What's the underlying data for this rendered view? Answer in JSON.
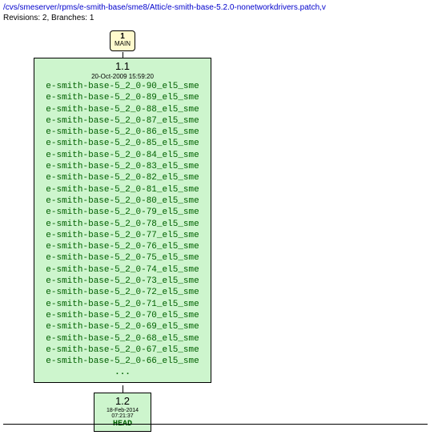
{
  "header": {
    "path": "/cvs/smeserver/rpms/e-smith-base/sme8/Attic/e-smith-base-5.2.0-nonetworkdrivers.patch,v",
    "info": "Revisions: 2, Branches: 1"
  },
  "branch": {
    "number": "1",
    "name": "MAIN"
  },
  "rev1": {
    "version": "1.1",
    "date": "20-Oct-2009 15:59:20",
    "tags": [
      "e-smith-base-5_2_0-90_el5_sme",
      "e-smith-base-5_2_0-89_el5_sme",
      "e-smith-base-5_2_0-88_el5_sme",
      "e-smith-base-5_2_0-87_el5_sme",
      "e-smith-base-5_2_0-86_el5_sme",
      "e-smith-base-5_2_0-85_el5_sme",
      "e-smith-base-5_2_0-84_el5_sme",
      "e-smith-base-5_2_0-83_el5_sme",
      "e-smith-base-5_2_0-82_el5_sme",
      "e-smith-base-5_2_0-81_el5_sme",
      "e-smith-base-5_2_0-80_el5_sme",
      "e-smith-base-5_2_0-79_el5_sme",
      "e-smith-base-5_2_0-78_el5_sme",
      "e-smith-base-5_2_0-77_el5_sme",
      "e-smith-base-5_2_0-76_el5_sme",
      "e-smith-base-5_2_0-75_el5_sme",
      "e-smith-base-5_2_0-74_el5_sme",
      "e-smith-base-5_2_0-73_el5_sme",
      "e-smith-base-5_2_0-72_el5_sme",
      "e-smith-base-5_2_0-71_el5_sme",
      "e-smith-base-5_2_0-70_el5_sme",
      "e-smith-base-5_2_0-69_el5_sme",
      "e-smith-base-5_2_0-68_el5_sme",
      "e-smith-base-5_2_0-67_el5_sme",
      "e-smith-base-5_2_0-66_el5_sme"
    ],
    "more": "..."
  },
  "rev2": {
    "version": "1.2",
    "date": "18-Feb-2014 07:21:37",
    "head": "HEAD"
  }
}
